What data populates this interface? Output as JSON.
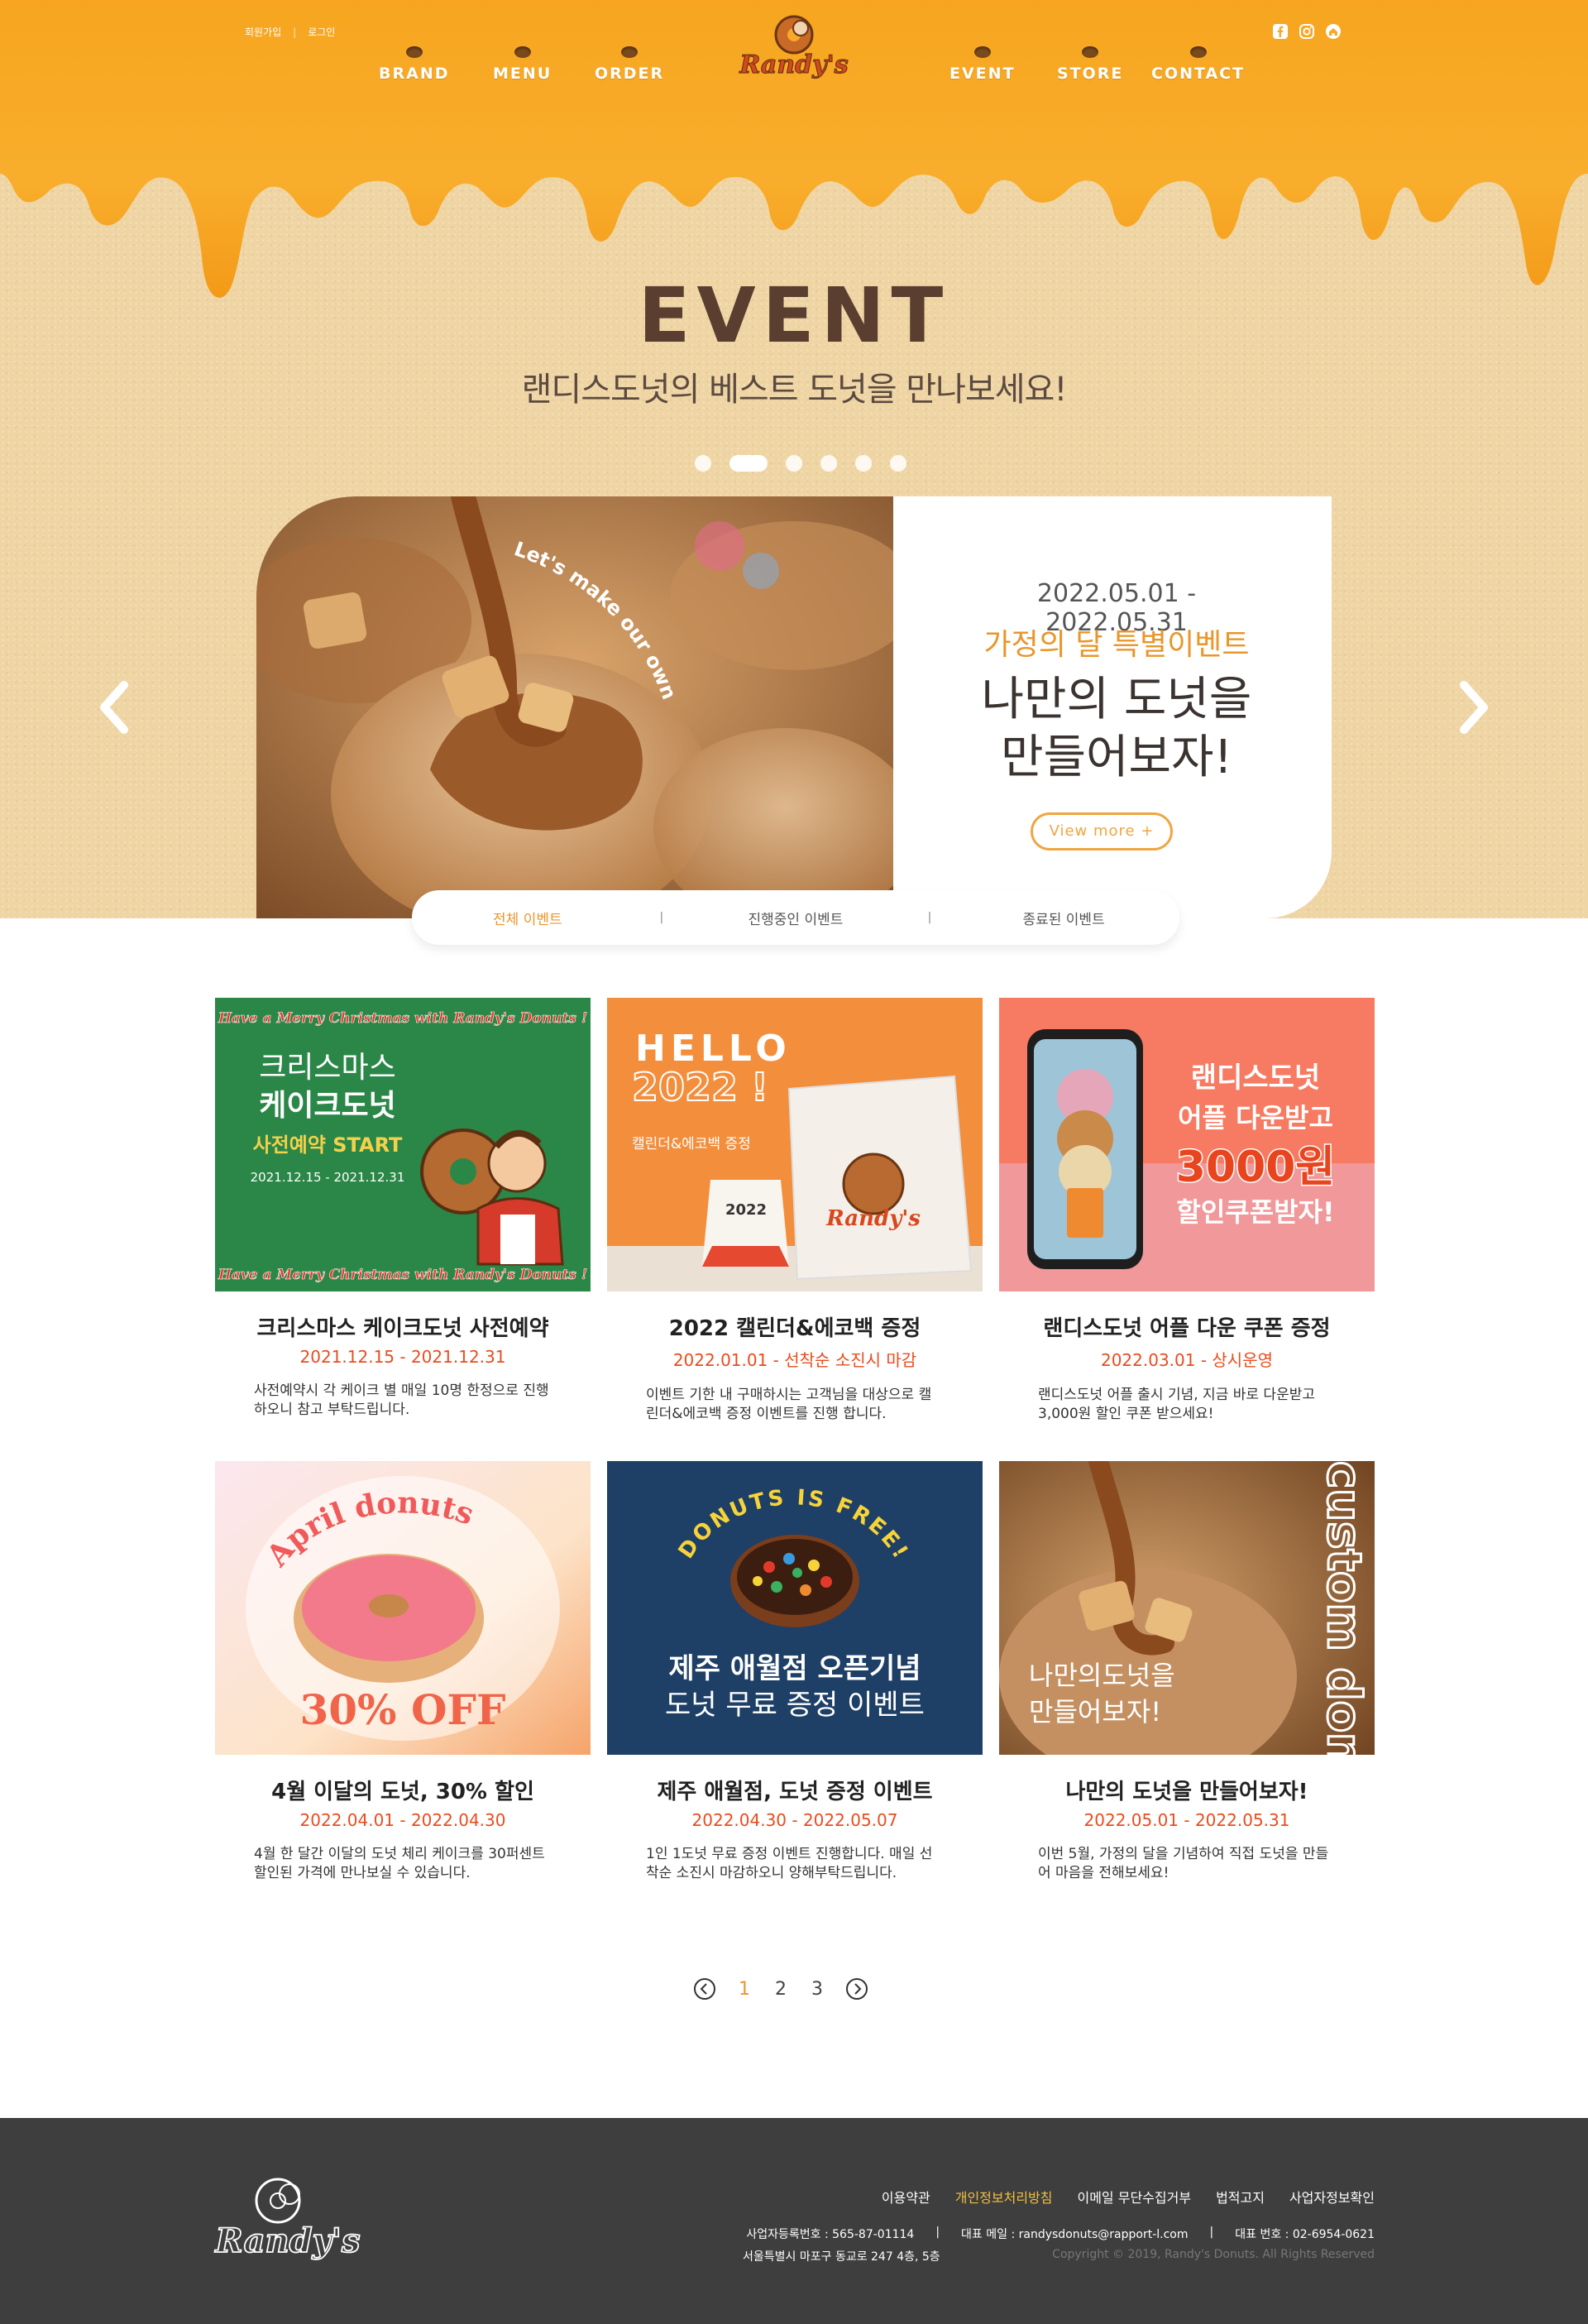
{
  "header": {
    "util_links": [
      "회원가입",
      "로그인"
    ],
    "nav_left": [
      "BRAND",
      "MENU",
      "ORDER"
    ],
    "nav_right": [
      "EVENT",
      "STORE",
      "CONTACT"
    ],
    "logo_text": "Randy's",
    "social_icons": [
      "facebook-icon",
      "instagram-icon",
      "home-icon"
    ]
  },
  "hero": {
    "title": "EVENT",
    "subtitle": "랜디스도넛의 베스트 도넛을 만나보세요!",
    "active_dot": 2,
    "dot_count": 6
  },
  "slide": {
    "photo_text": "Let's make our own donuts!",
    "date": "2022.05.01 - 2022.05.31",
    "subtitle": "가정의 달 특별이벤트",
    "title_line1": "나만의 도넛을",
    "title_line2": "만들어보자!",
    "button": "View more +"
  },
  "tabs": [
    "전체 이벤트",
    "진행중인 이벤트",
    "종료된 이벤트"
  ],
  "events": [
    {
      "title": "크리스마스 케이크도넛 사전예약",
      "date": "2021.12.15 - 2021.12.31",
      "desc": "사전예약시 각 케이크 별 매일 10명 한정으로 진행하오니 참고 부탁드립니다.",
      "img": {
        "banner": "Have a Merry Christmas with Randy's Donuts !",
        "line1": "크리스마스",
        "line2": "케이크도넛",
        "line3": "사전예약 START",
        "line4": "2021.12.15 - 2021.12.31"
      }
    },
    {
      "title": "2022 캘린더&에코백 증정",
      "date": "2022.01.01 - 선착순 소진시 마감",
      "desc": "이벤트 기한 내 구매하시는 고객님을 대상으로 캘린더&에코백 증정 이벤트를 진행 합니다.",
      "img": {
        "line1": "HELLO",
        "line2": "2022 !",
        "line3": "캘린더&에코백 증정",
        "cal": "2022"
      }
    },
    {
      "title": "랜디스도넛 어플 다운 쿠폰 증정",
      "date": "2022.03.01 - 상시운영",
      "desc": "랜디스도넛 어플 출시 기념, 지금 바로 다운받고 3,000원 할인 쿠폰 받으세요!",
      "img": {
        "line1": "랜디스도넛",
        "line2": "어플 다운받고",
        "line3": "3000원",
        "line4": "할인쿠폰받자!"
      }
    },
    {
      "title": "4월 이달의 도넛, 30% 할인",
      "date": "2022.04.01 - 2022.04.30",
      "desc": "4월 한 달간 이달의 도넛 체리 케이크를 30퍼센트 할인된 가격에 만나보실 수 있습니다.",
      "img": {
        "line1": "April donuts",
        "line2": "30% OFF"
      }
    },
    {
      "title": "제주 애월점, 도넛 증정 이벤트",
      "date": "2022.04.30 - 2022.05.07",
      "desc": "1인 1도넛 무료 증정 이벤트 진행합니다. 매일 선착순 소진시 마감하오니 양해부탁드립니다.",
      "img": {
        "line1": "DONUTS IS FREE!",
        "line2": "제주 애월점 오픈기념",
        "line3": "도넛 무료 증정 이벤트"
      }
    },
    {
      "title": "나만의 도넛을 만들어보자!",
      "date": "2022.05.01 - 2022.05.31",
      "desc": "이번 5월, 가정의 달을 기념하여 직접 도넛을 만들어 마음을 전해보세요!",
      "img": {
        "line1": "나만의도넛을",
        "line2": "만들어보자!",
        "side": "custom donuts"
      }
    }
  ],
  "pager": {
    "pages": [
      "1",
      "2",
      "3"
    ],
    "active": "1"
  },
  "footer": {
    "logo_text": "Randy's",
    "links": [
      "이용약관",
      "개인정보처리방침",
      "이메일 무단수집거부",
      "법적고지",
      "사업자정보확인"
    ],
    "biz_no": "사업자등록번호 : 565-87-01114",
    "email": "대표 메일 : randysdonuts@rapport-l.com",
    "phone": "대표 번호 : 02-6954-0621",
    "address": "서울특별시 마포구 동교로 247 4층, 5층",
    "copyright": "Copyright © 2019, Randy's Donuts. All Rights Reserved",
    "highlight_color": "#f0c040"
  },
  "colors": {
    "accent": "#e9962a",
    "date_red": "#ea4c1e",
    "syrup": "#f7a929",
    "brown": "#5a3e30"
  }
}
